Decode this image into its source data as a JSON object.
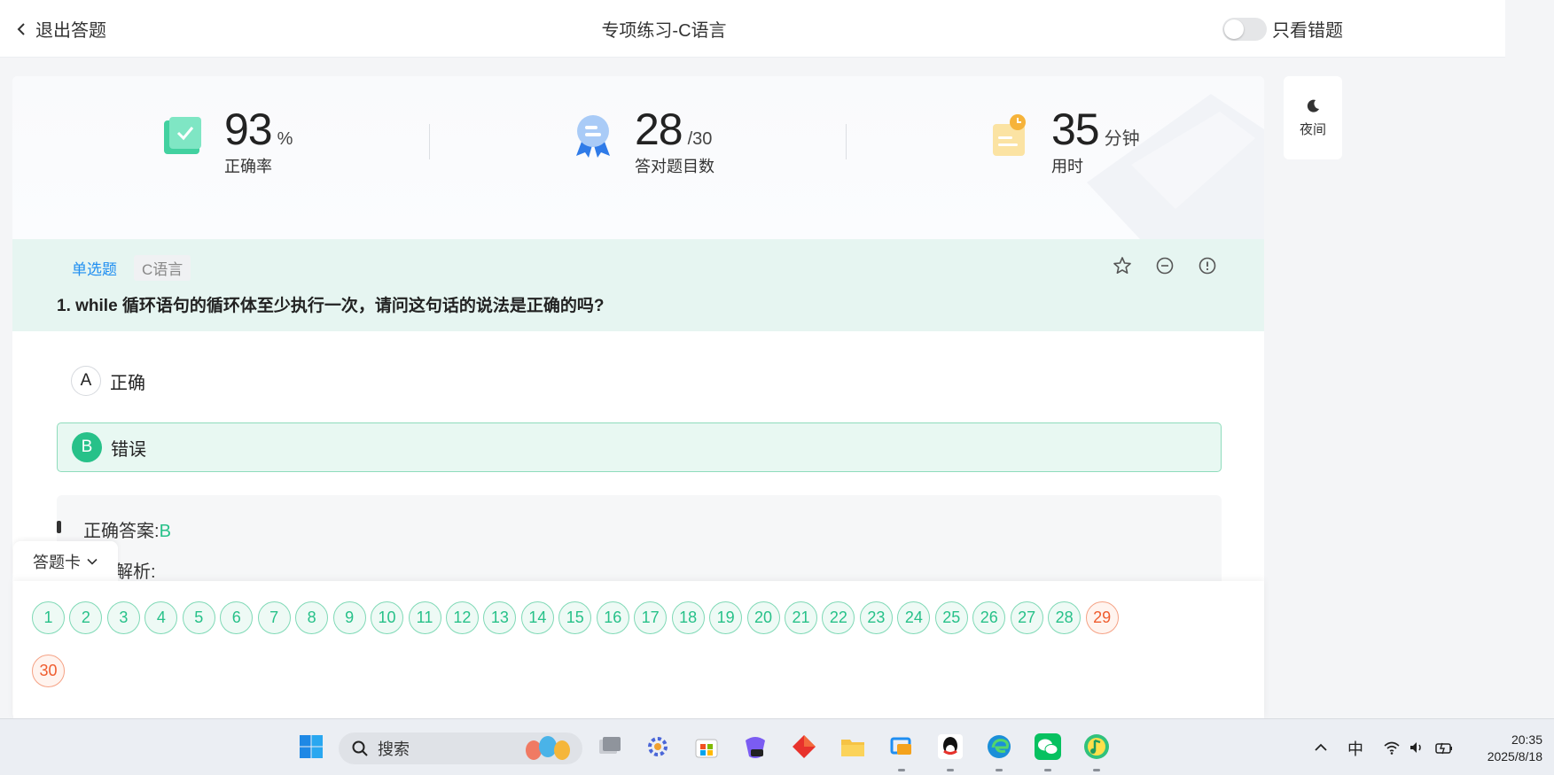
{
  "header": {
    "back_label": "退出答题",
    "title": "专项练习-C语言",
    "toggle_label": "只看错题",
    "toggle_on": false
  },
  "night_mode": {
    "label": "夜间",
    "icon": "moon-icon"
  },
  "stats": [
    {
      "value": "93",
      "unit": "%",
      "label": "正确率",
      "icon": "check-book-icon"
    },
    {
      "value": "28",
      "unit": "/30",
      "label": "答对题目数",
      "icon": "award-badge-icon"
    },
    {
      "value": "35",
      "unit": "分钟",
      "label": "用时",
      "icon": "timer-note-icon"
    }
  ],
  "question": {
    "type_tag": "单选题",
    "lang_tag": "C语言",
    "text": "1. while 循环语句的循环体至少执行一次，请问这句话的说法是正确的吗?",
    "actions": [
      "star-icon",
      "minus-circle-icon",
      "info-circle-icon"
    ],
    "options": [
      {
        "letter": "A",
        "text": "正确",
        "selected": false
      },
      {
        "letter": "B",
        "text": "错误",
        "selected": true
      }
    ],
    "answer_label": "正确答案:",
    "answer_value": "B",
    "analysis_label": "解析:"
  },
  "answer_sheet": {
    "tab_label": "答题卡",
    "items": [
      {
        "n": "1",
        "status": "correct"
      },
      {
        "n": "2",
        "status": "correct"
      },
      {
        "n": "3",
        "status": "correct"
      },
      {
        "n": "4",
        "status": "correct"
      },
      {
        "n": "5",
        "status": "correct"
      },
      {
        "n": "6",
        "status": "correct"
      },
      {
        "n": "7",
        "status": "correct"
      },
      {
        "n": "8",
        "status": "correct"
      },
      {
        "n": "9",
        "status": "correct"
      },
      {
        "n": "10",
        "status": "correct"
      },
      {
        "n": "11",
        "status": "correct"
      },
      {
        "n": "12",
        "status": "correct"
      },
      {
        "n": "13",
        "status": "correct"
      },
      {
        "n": "14",
        "status": "correct"
      },
      {
        "n": "15",
        "status": "correct"
      },
      {
        "n": "16",
        "status": "correct"
      },
      {
        "n": "17",
        "status": "correct"
      },
      {
        "n": "18",
        "status": "correct"
      },
      {
        "n": "19",
        "status": "correct"
      },
      {
        "n": "20",
        "status": "correct"
      },
      {
        "n": "21",
        "status": "correct"
      },
      {
        "n": "22",
        "status": "correct"
      },
      {
        "n": "23",
        "status": "correct"
      },
      {
        "n": "24",
        "status": "correct"
      },
      {
        "n": "25",
        "status": "correct"
      },
      {
        "n": "26",
        "status": "correct"
      },
      {
        "n": "27",
        "status": "correct"
      },
      {
        "n": "28",
        "status": "correct"
      },
      {
        "n": "29",
        "status": "wrong"
      },
      {
        "n": "30",
        "status": "wrong"
      }
    ]
  },
  "colors": {
    "accent_green": "#27c189",
    "wrong_orange": "#ef5c2e",
    "question_bg": "#e6f5f1",
    "tag_blue": "#1f8ef1"
  },
  "taskbar": {
    "search_placeholder": "搜索",
    "apps": [
      "windows-start-icon",
      "task-view-icon",
      "settings-app-icon",
      "store-icon",
      "m365-copilot-icon",
      "red-diamond-app-icon",
      "file-explorer-icon",
      "remote-desktop-icon",
      "qq-icon",
      "edge-icon",
      "wechat-icon",
      "qq-music-icon"
    ],
    "ime": "中",
    "time": "20:35",
    "date": "2025/8/18"
  }
}
